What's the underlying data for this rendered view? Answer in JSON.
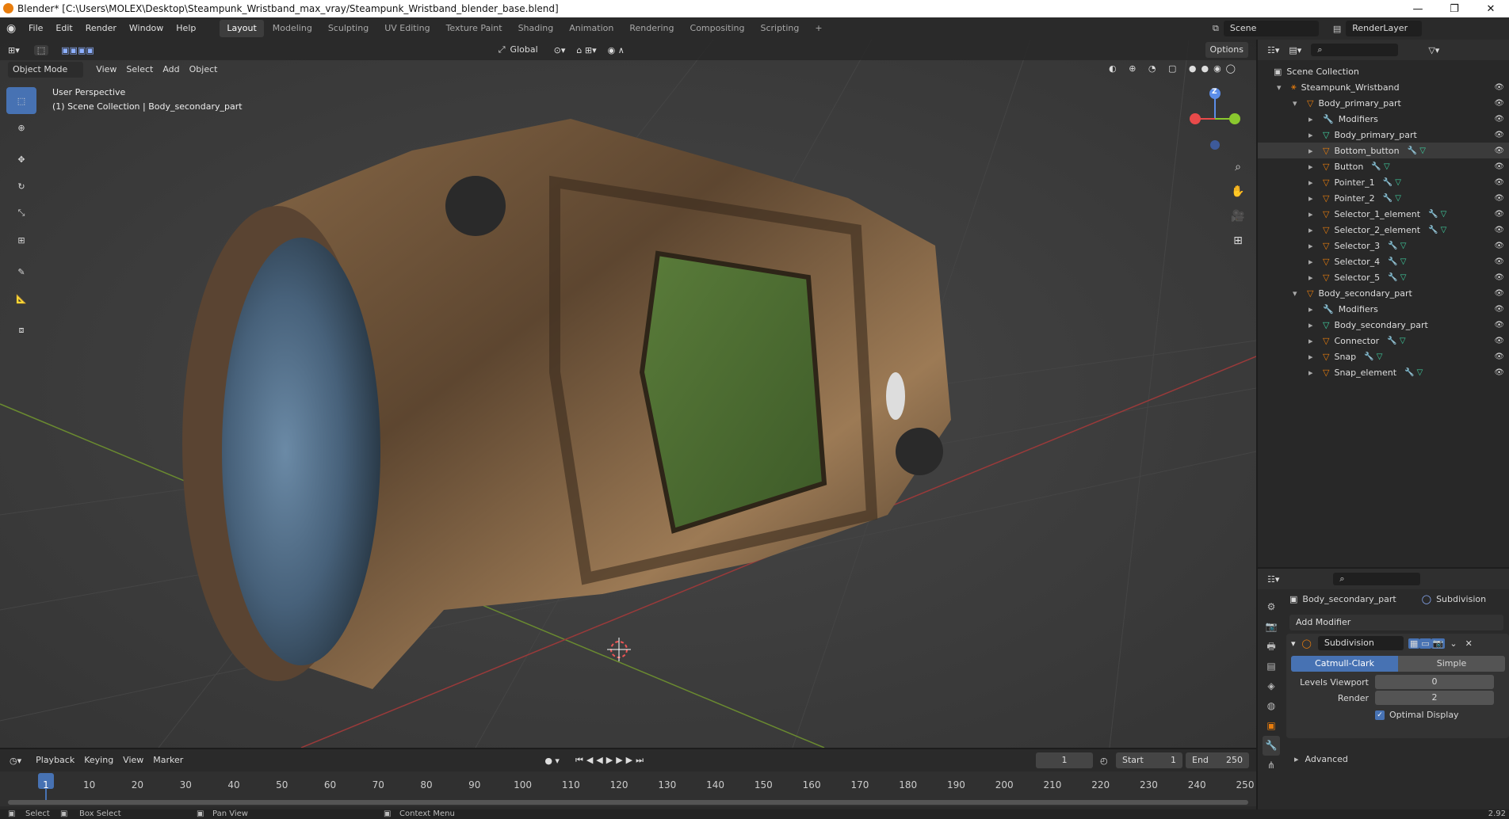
{
  "window": {
    "title": "Blender* [C:\\Users\\MOLEX\\Desktop\\Steampunk_Wristband_max_vray/Steampunk_Wristband_blender_base.blend]",
    "controls": [
      "—",
      "❐",
      "✕"
    ]
  },
  "menu": {
    "items": [
      "File",
      "Edit",
      "Render",
      "Window",
      "Help"
    ],
    "workspaces": [
      "Layout",
      "Modeling",
      "Sculpting",
      "UV Editing",
      "Texture Paint",
      "Shading",
      "Animation",
      "Rendering",
      "Compositing",
      "Scripting"
    ],
    "active_workspace": "Layout",
    "add_tab": "+",
    "scene": "Scene",
    "render_layer": "RenderLayer"
  },
  "viewport_header": {
    "mode": "Object Mode",
    "menus": [
      "View",
      "Select",
      "Add",
      "Object"
    ],
    "transform_orientation": "Global",
    "options": "Options"
  },
  "viewport": {
    "perspective": "User Perspective",
    "collection_info": "(1) Scene Collection | Body_secondary_part",
    "gizmo_axis": "Z"
  },
  "outliner": {
    "root": "Scene Collection",
    "rows": [
      {
        "label": "Steampunk_Wristband",
        "depth": 0,
        "icon": "empty",
        "expanded": true
      },
      {
        "label": "Body_primary_part",
        "depth": 1,
        "icon": "mesh",
        "expanded": true
      },
      {
        "label": "Modifiers",
        "depth": 2,
        "icon": "wrench"
      },
      {
        "label": "Body_primary_part",
        "depth": 2,
        "icon": "mesh-data"
      },
      {
        "label": "Bottom_button",
        "depth": 2,
        "icon": "mesh",
        "selected": true
      },
      {
        "label": "Button",
        "depth": 2,
        "icon": "mesh"
      },
      {
        "label": "Pointer_1",
        "depth": 2,
        "icon": "mesh"
      },
      {
        "label": "Pointer_2",
        "depth": 2,
        "icon": "mesh"
      },
      {
        "label": "Selector_1_element",
        "depth": 2,
        "icon": "mesh"
      },
      {
        "label": "Selector_2_element",
        "depth": 2,
        "icon": "mesh"
      },
      {
        "label": "Selector_3",
        "depth": 2,
        "icon": "mesh"
      },
      {
        "label": "Selector_4",
        "depth": 2,
        "icon": "mesh"
      },
      {
        "label": "Selector_5",
        "depth": 2,
        "icon": "mesh"
      },
      {
        "label": "Body_secondary_part",
        "depth": 1,
        "icon": "mesh",
        "expanded": true
      },
      {
        "label": "Modifiers",
        "depth": 2,
        "icon": "wrench"
      },
      {
        "label": "Body_secondary_part",
        "depth": 2,
        "icon": "mesh-data"
      },
      {
        "label": "Connector",
        "depth": 2,
        "icon": "mesh"
      },
      {
        "label": "Snap",
        "depth": 2,
        "icon": "mesh"
      },
      {
        "label": "Snap_element",
        "depth": 2,
        "icon": "mesh"
      }
    ]
  },
  "properties": {
    "object": "Body_secondary_part",
    "modifier_context": "Subdivision",
    "add_modifier": "Add Modifier",
    "modifier_name": "Subdivision",
    "algo_options": [
      "Catmull-Clark",
      "Simple"
    ],
    "active_algo": "Catmull-Clark",
    "levels_viewport_label": "Levels Viewport",
    "levels_viewport": "0",
    "render_label": "Render",
    "render_value": "2",
    "optimal_display": "Optimal Display",
    "advanced": "Advanced"
  },
  "timeline": {
    "menus": [
      "Playback",
      "Keying",
      "View",
      "Marker"
    ],
    "current_frame": "1",
    "start_label": "Start",
    "start": "1",
    "end_label": "End",
    "end": "250",
    "ticks": [
      "1",
      "10",
      "20",
      "30",
      "40",
      "50",
      "60",
      "70",
      "80",
      "90",
      "100",
      "110",
      "120",
      "130",
      "140",
      "150",
      "160",
      "170",
      "180",
      "190",
      "200",
      "210",
      "220",
      "230",
      "240",
      "250"
    ]
  },
  "status": {
    "select": "Select",
    "box_select": "Box Select",
    "pan_view": "Pan View",
    "context_menu": "Context Menu",
    "version": "2.92"
  }
}
